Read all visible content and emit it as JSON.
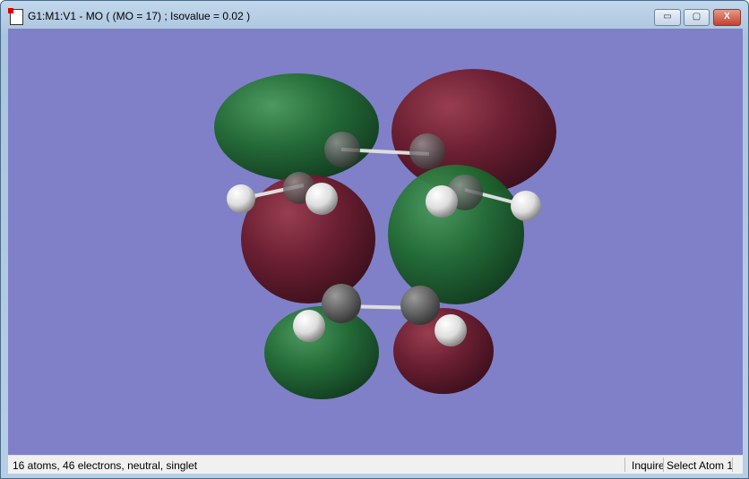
{
  "window": {
    "title": "G1:M1:V1 - MO ( (MO = 17) ; Isovalue = 0.02 )"
  },
  "controls": {
    "minimize": "▭",
    "maximize": "▢",
    "close": "X"
  },
  "colors": {
    "background": "#8080c9",
    "positive_lobe": "#1a6a2e",
    "negative_lobe": "#6a1a2a"
  },
  "status": {
    "info": "16 atoms, 46 electrons, neutral, singlet",
    "mode": "Inquire",
    "action": "Select Atom 1"
  }
}
